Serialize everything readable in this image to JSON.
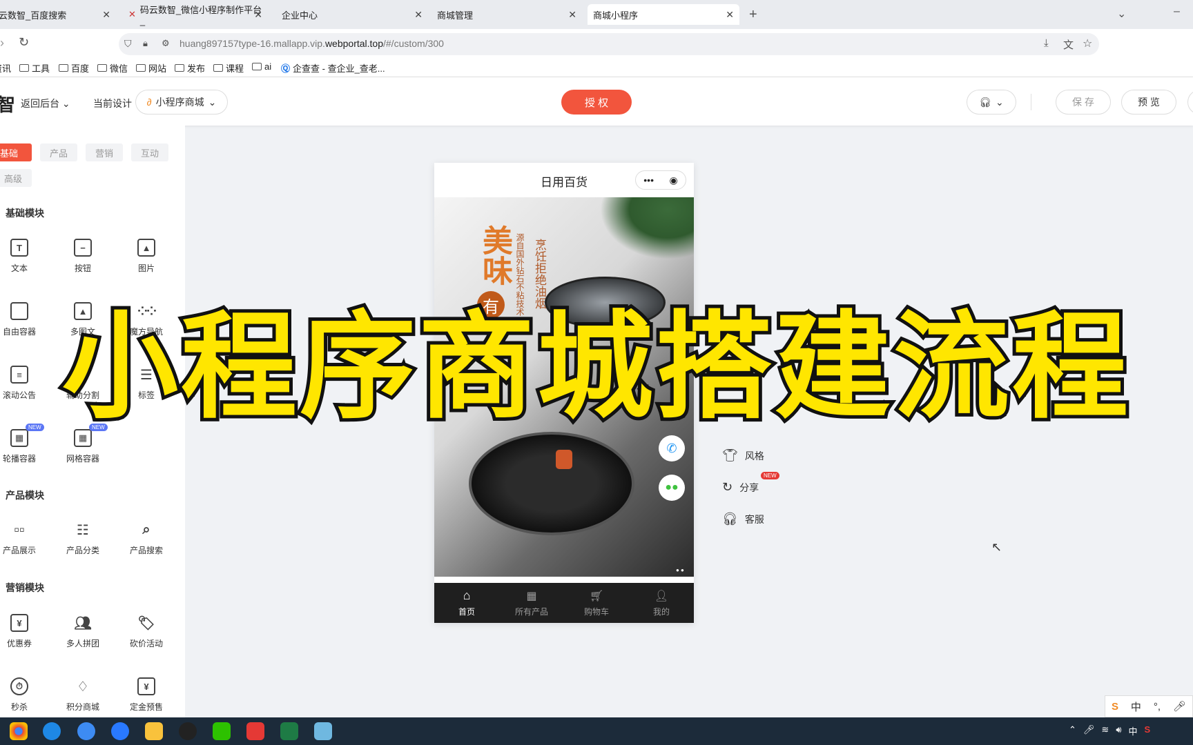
{
  "browser": {
    "tabs": [
      {
        "label": "云数智_百度搜索"
      },
      {
        "label": "码云数智_微信小程序制作平台_"
      },
      {
        "label": "企业中心"
      },
      {
        "label": "商城管理"
      },
      {
        "label": "商城小程序"
      }
    ],
    "url_prefix": "huang897157type-16.mallapp.vip.",
    "url_domain": "webportal.top",
    "url_suffix": "/#/custom/300",
    "bookmarks": [
      "资讯",
      "工具",
      "百度",
      "微信",
      "网站",
      "发布",
      "课程",
      "ai",
      "企查查 - 查企业_查老..."
    ]
  },
  "header": {
    "logo": "智",
    "back_label": "返回后台",
    "current_design_label": "当前设计",
    "design_name": "小程序商城",
    "authorize_label": "授 权",
    "save_label": "保 存",
    "preview_label": "预 览"
  },
  "left_panel": {
    "categories": [
      "基础",
      "产品",
      "营销",
      "互动",
      "高级"
    ],
    "sections": [
      {
        "title": "基础模块",
        "items": [
          "文本",
          "按钮",
          "图片",
          "自由容器",
          "多图文",
          "魔方导航",
          "滚动公告",
          "辅助分割",
          "标签",
          "轮播容器",
          "网格容器"
        ]
      },
      {
        "title": "产品模块",
        "items": [
          "产品展示",
          "产品分类",
          "产品搜索"
        ]
      },
      {
        "title": "营销模块",
        "items": [
          "优惠券",
          "多人拼团",
          "砍价活动",
          "秒杀",
          "积分商城",
          "定金预售"
        ]
      }
    ],
    "new_badge": "NEW"
  },
  "phone": {
    "title": "日用百货",
    "banner_text_big": "美味",
    "banner_text_circle": "有",
    "banner_text_col1": "烹饪拒绝油烟",
    "banner_text_col2": "源自国外钻石不粘技术",
    "tabs": [
      "首页",
      "所有产品",
      "购物车",
      "我的"
    ]
  },
  "props": {
    "items": [
      "风格",
      "分享",
      "客服"
    ],
    "new_badge": "NEW"
  },
  "overlay": {
    "title": "小程序商城搭建流程"
  },
  "ime": {
    "lang": "中"
  },
  "colors": {
    "accent": "#f2553d",
    "overlay_text": "#ffe600"
  }
}
